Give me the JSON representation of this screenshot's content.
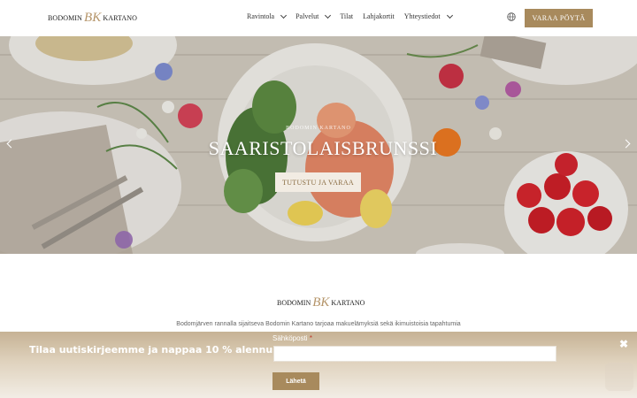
{
  "header": {
    "logo_left": "BODOMIN",
    "logo_mono": "BK",
    "logo_right": "KARTANO",
    "nav": [
      {
        "label": "Ravintola",
        "has_dropdown": true
      },
      {
        "label": "Palvelut",
        "has_dropdown": true
      },
      {
        "label": "Tilat",
        "has_dropdown": false
      },
      {
        "label": "Lahjakortit",
        "has_dropdown": false
      },
      {
        "label": "Yhteystiedot",
        "has_dropdown": true
      }
    ],
    "language_icon": "globe-icon",
    "book_button": "VARAA PÖYTÄ"
  },
  "hero": {
    "subtitle": "BODOMIN KARTANO",
    "title": "SAARISTOLAISBRUNSSI",
    "cta": "TUTUSTU JA VARAA"
  },
  "intro": {
    "logo_left": "BODOMIN",
    "logo_mono": "BK",
    "logo_right": "KARTANO",
    "text": "Bodomjärven rannalla sijaitseva Bodomin Kartano tarjoaa makuelämyksiä sekä ikimuistoisia tapahtumia"
  },
  "newsletter": {
    "title": "Tilaa uutiskirjeemme ja nappaa 10 % alennus! ·",
    "email_label": "Sähköposti",
    "required_mark": "*",
    "email_value": "",
    "submit": "Lähetä"
  },
  "colors": {
    "accent": "#a88a5d",
    "logo_gold": "#b5956a"
  }
}
